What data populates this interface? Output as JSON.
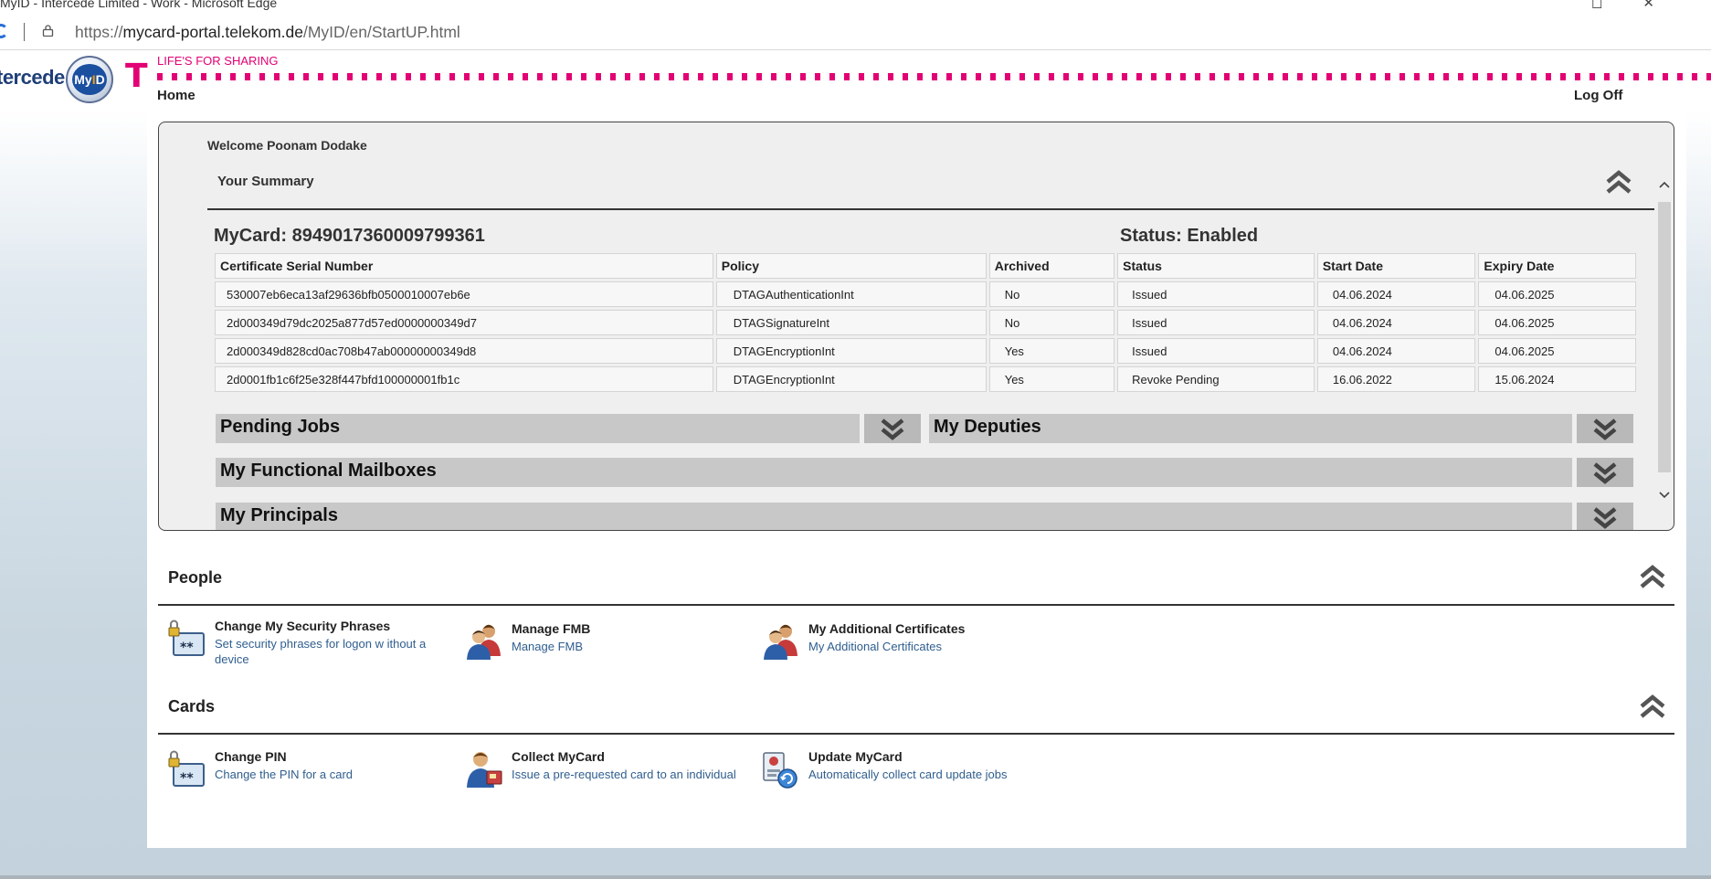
{
  "browser": {
    "window_title": "MyID - Intercede Limited - Work - Microsoft Edge",
    "url_prefix": "https://",
    "url_domain": "mycard-portal.telekom.de",
    "url_path": "/MyID/en/StartUP.html"
  },
  "header": {
    "brand_word": "tercede",
    "brand_badge_left": "My",
    "brand_badge_i": "I",
    "brand_badge_right": "D",
    "t_logo": "T",
    "slogan": "LIFE'S FOR SHARING",
    "nav_home": "Home",
    "nav_logoff": "Log Off"
  },
  "summary": {
    "welcome": "Welcome Poonam Dodake",
    "title": "Your Summary",
    "mycard": "MyCard: 8949017360009799361",
    "status": "Status: Enabled",
    "columns": [
      "Certificate Serial Number",
      "Policy",
      "Archived",
      "Status",
      "Start Date",
      "Expiry Date"
    ],
    "rows": [
      [
        "530007eb6eca13af29636bfb0500010007eb6e",
        "DTAGAuthenticationInt",
        "No",
        "Issued",
        "04.06.2024",
        "04.06.2025"
      ],
      [
        "2d000349d79dc2025a877d57ed0000000349d7",
        "DTAGSignatureInt",
        "No",
        "Issued",
        "04.06.2024",
        "04.06.2025"
      ],
      [
        "2d000349d828cd0ac708b47ab00000000349d8",
        "DTAGEncryptionInt",
        "Yes",
        "Issued",
        "04.06.2024",
        "04.06.2025"
      ],
      [
        "2d0001fb1c6f25e328f447bfd100000001fb1c",
        "DTAGEncryptionInt",
        "Yes",
        "Revoke Pending",
        "16.06.2022",
        "15.06.2024"
      ]
    ],
    "pending_jobs": "Pending Jobs",
    "my_deputies": "My Deputies",
    "functional_mailboxes": "My Functional Mailboxes",
    "principals": "My Principals"
  },
  "people": {
    "title": "People",
    "items": [
      {
        "title": "Change My Security Phrases",
        "desc": "Set security phrases for logon w ithout a device",
        "icon": "lock-keypad-icon"
      },
      {
        "title": "Manage FMB",
        "desc": "Manage FMB",
        "icon": "users-icon"
      },
      {
        "title": "My Additional Certificates",
        "desc": "My Additional Certificates",
        "icon": "users-icon"
      }
    ]
  },
  "cards": {
    "title": "Cards",
    "items": [
      {
        "title": "Change PIN",
        "desc": "Change the PIN for a card",
        "icon": "lock-keypad-icon"
      },
      {
        "title": "Collect MyCard",
        "desc": "Issue a pre-requested card to an individual",
        "icon": "user-card-icon"
      },
      {
        "title": "Update MyCard",
        "desc": "Automatically collect card update jobs",
        "icon": "card-update-icon"
      }
    ]
  },
  "colors": {
    "telekom_magenta": "#e20074",
    "link_blue": "#2f5e8e",
    "panel_gray": "#efefef",
    "bar_gray": "#c8c8c8"
  }
}
